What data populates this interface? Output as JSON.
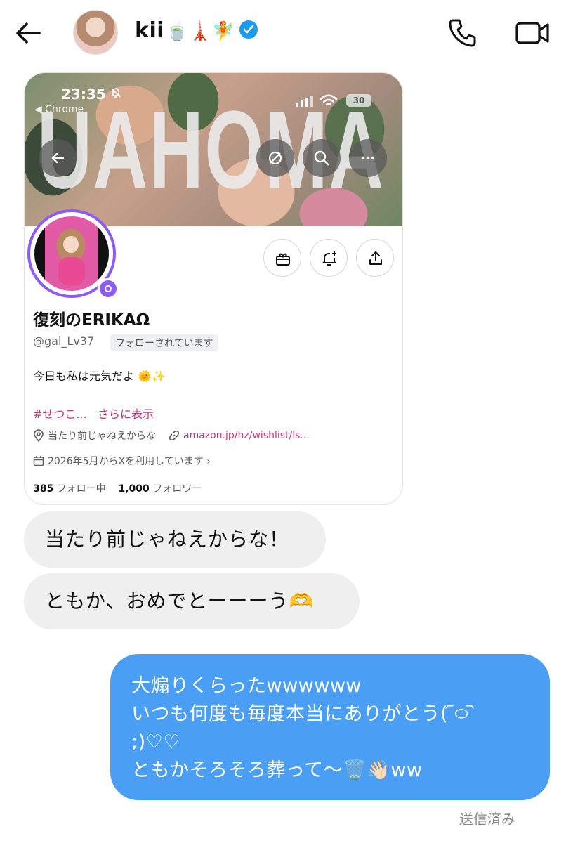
{
  "header": {
    "contact_name": "kii",
    "contact_emoji": "🍵🗼🧚",
    "icons": [
      "back-arrow-icon",
      "verified-badge-icon",
      "phone-icon",
      "video-camera-icon"
    ]
  },
  "shared_screenshot": {
    "status_bar": {
      "time": "23:35",
      "app_back_label": "◀ Chrome",
      "battery": "30"
    },
    "banner_text": "UAHOMA",
    "display_name": "復刻のERIKAΩ",
    "handle": "@gal_Lv37",
    "follows_you": "フォローされています",
    "bio": "今日も私は元気だよ 🌞✨",
    "hashtag": "#せつこ...",
    "show_more": "さらに表示",
    "location": "当たり前じゃねえからな",
    "link": "amazon.jp/hz/wishlist/ls...",
    "joined": "2026年5月からXを利用しています ›",
    "following_count": "385",
    "following_label": "フォロー中",
    "followers_count": "1,000",
    "followers_label": "フォロワー"
  },
  "messages": {
    "received_1": "当たり前じゃねえからな！",
    "received_2": "ともか、おめでとーーーう🫶",
    "sent_line_1": "大煽りくらったwwwwww",
    "sent_line_2": "いつも何度も毎度本当にありがとう( ᷇࿀ ᷆",
    "sent_line_3": ";)♡♡",
    "sent_line_4": "ともかそろそろ葬って〜🗑️👋🏻ww",
    "sent_status": "送信済み"
  },
  "colors": {
    "sent_bubble": "#4a9ff5",
    "received_bubble": "#efefef",
    "link_pink": "#c0397e",
    "verified_blue": "#1d9bf0",
    "avatar_ring": "#8b5cf6"
  }
}
